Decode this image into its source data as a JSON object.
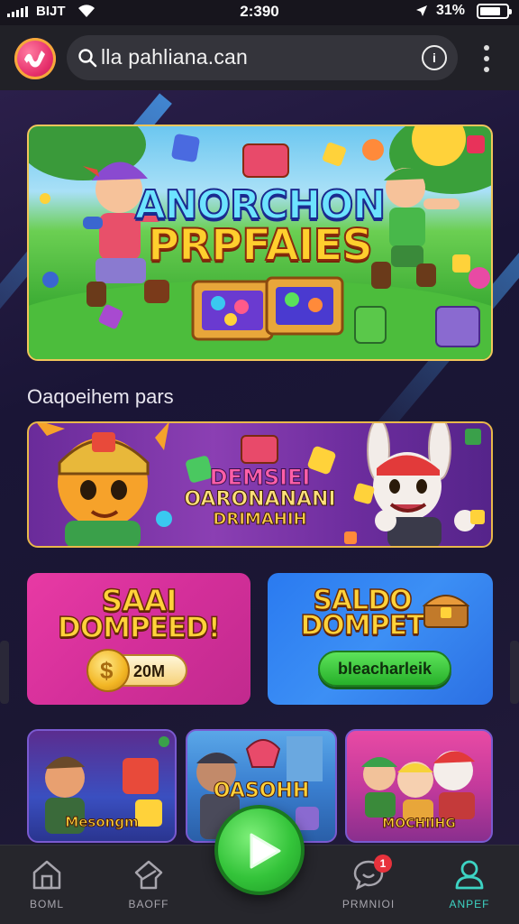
{
  "status_bar": {
    "carrier": "BIJT",
    "time": "2:390",
    "battery_pct": "31%"
  },
  "browser": {
    "url": "lla pahliana.can",
    "info_icon": "i"
  },
  "hero": {
    "title_line1": "ANORCHON",
    "title_line2": "PRPFAIES"
  },
  "section": {
    "title": "Oaqoeihem pars"
  },
  "promo": {
    "line1": "DEMSIEI",
    "line2": "OARONANANI",
    "line3": "DRIMAHIH"
  },
  "tiles": {
    "left": {
      "line1": "SAAI",
      "line2": "DOMPEED!",
      "amount": "20M",
      "coin_symbol": "$"
    },
    "right": {
      "line1": "SALDO",
      "line2": "DOMPET",
      "button": "bleacharleik"
    }
  },
  "games": [
    {
      "label": "Mesongm"
    },
    {
      "label": "OASOHH"
    },
    {
      "label": "MOCHIIHG"
    }
  ],
  "nav": {
    "items": [
      {
        "label": "BOML"
      },
      {
        "label": "BAOFF"
      },
      {
        "label": "PRMNIOI",
        "badge": "1"
      },
      {
        "label": "ANPEF"
      }
    ]
  },
  "colors": {
    "accent_teal": "#3dd3c3",
    "play_green": "#34c43a",
    "badge_red": "#e8323c",
    "frame_gold": "#f2c65a"
  }
}
